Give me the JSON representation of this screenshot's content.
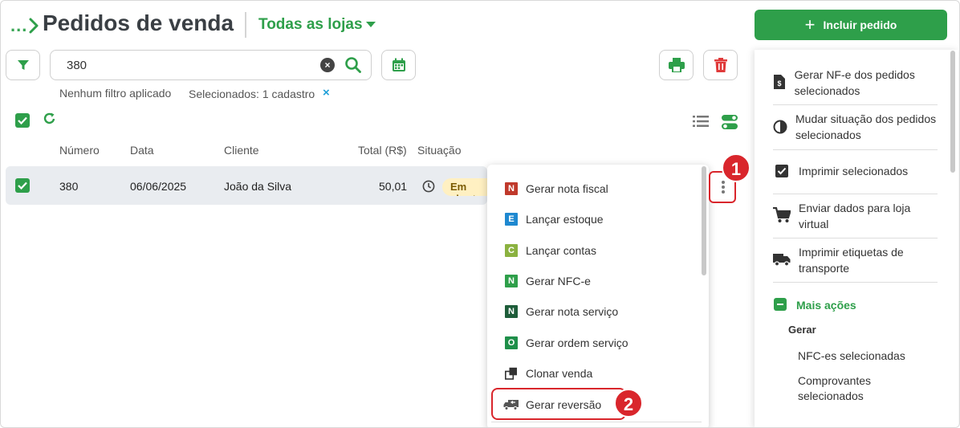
{
  "header": {
    "breadcrumb_more": "...",
    "title": "Pedidos de venda",
    "store_selector": "Todas as lojas"
  },
  "search": {
    "value": "380"
  },
  "filters": {
    "applied": "Nenhum filtro aplicado",
    "selected": "Selecionados: 1 cadastro",
    "selected_clear": "×"
  },
  "table": {
    "columns": [
      "Número",
      "Data",
      "Cliente",
      "Total (R$)",
      "Situação"
    ],
    "rows": [
      {
        "numero": "380",
        "data": "06/06/2025",
        "cliente": "João da Silva",
        "total": "50,01",
        "situacao": "Em aberto"
      }
    ]
  },
  "row_menu": {
    "items": [
      {
        "label": "Gerar nota fiscal",
        "badge": "N",
        "color": "#c0392b"
      },
      {
        "label": "Lançar estoque",
        "badge": "E",
        "color": "#1e88d0"
      },
      {
        "label": "Lançar contas",
        "badge": "C",
        "color": "#8bb240"
      },
      {
        "label": "Gerar NFC-e",
        "badge": "N",
        "color": "#2e9f4a"
      },
      {
        "label": "Gerar nota serviço",
        "badge": "N",
        "color": "#1e5d3a"
      },
      {
        "label": "Gerar ordem serviço",
        "badge": "O",
        "color": "#1f8f4a"
      },
      {
        "label": "Clonar venda",
        "icon": "clone-icon"
      },
      {
        "label": "Gerar reversão",
        "icon": "truck-return-icon"
      }
    ]
  },
  "annotations": {
    "step1": "1",
    "step2": "2"
  },
  "side": {
    "include_button": "Incluir pedido",
    "actions": [
      {
        "label": "Gerar NF-e dos pedidos selecionados",
        "icon": "invoice-icon"
      },
      {
        "label": "Mudar situação dos pedidos selecionados",
        "icon": "contrast-icon"
      },
      {
        "label": "Imprimir selecionados",
        "icon": "checkbox-icon"
      },
      {
        "label": "Enviar dados para loja virtual",
        "icon": "cart-icon"
      },
      {
        "label": "Imprimir etiquetas de transporte",
        "icon": "truck-icon"
      }
    ],
    "more_actions": "Mais ações",
    "generate_heading": "Gerar",
    "generate_items": [
      "NFC-es selecionadas",
      "Comprovantes selecionados"
    ]
  },
  "colors": {
    "brand_green": "#2e9f4a",
    "annotation_red": "#d9262c",
    "link_blue": "#1e9fd8"
  }
}
